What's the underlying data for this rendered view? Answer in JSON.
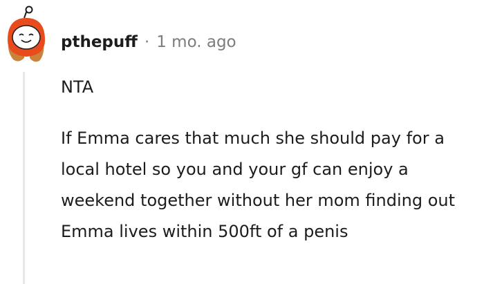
{
  "comment": {
    "username": "pthepuff",
    "separator": "·",
    "timestamp": "1 mo. ago",
    "avatar_icon": "reddit-snoo-avatar-icon",
    "paragraphs": [
      "NTA",
      "If Emma cares that much she should pay for a local hotel so you and your gf can enjoy a weekend together without her mom finding out Emma lives within 500ft of a penis"
    ],
    "colors": {
      "avatar_hood": "#e84b1c",
      "avatar_hair": "#c9833a",
      "text": "#1c1c1c",
      "meta": "#7c7c7c",
      "thread_line": "#e8e8e8"
    }
  }
}
